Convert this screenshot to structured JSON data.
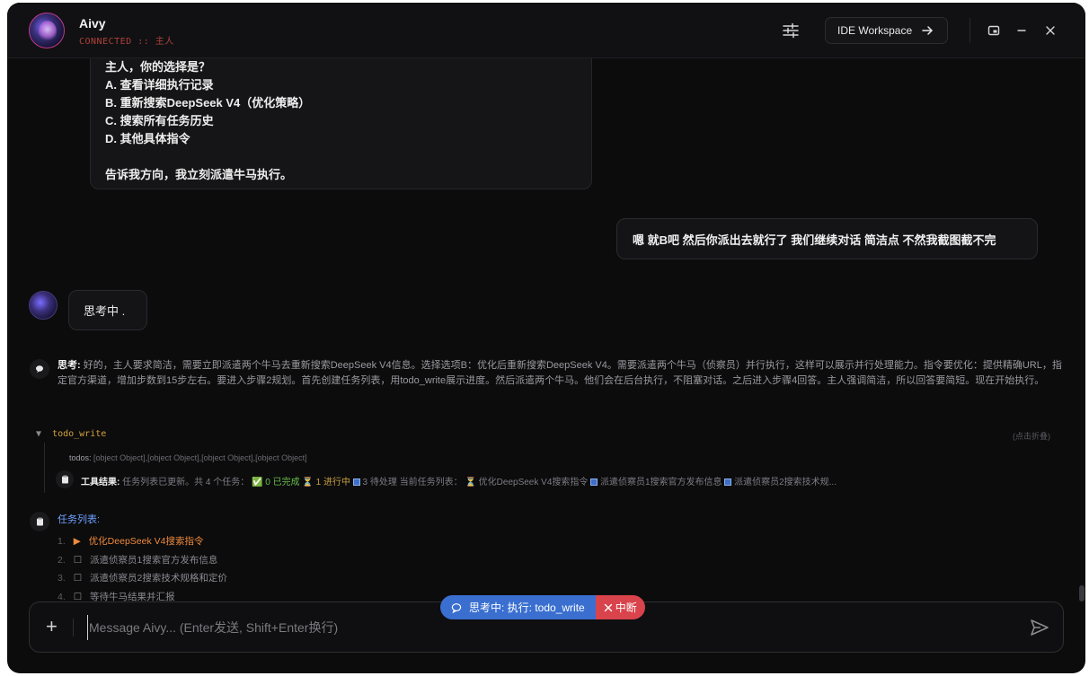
{
  "header": {
    "app_name": "Aivy",
    "connection_status": "CONNECTED :: 主人",
    "ide_button_label": "IDE Workspace",
    "icons": [
      "settings-sliders-icon",
      "arrow-right-icon",
      "picture-in-picture-icon",
      "minimize-icon",
      "close-icon"
    ]
  },
  "messages": {
    "ai_options": {
      "lines": [
        "主人，你的选择是？",
        "A. 查看详细执行记录",
        "B. 重新搜索DeepSeek V4（优化策略）",
        "C. 搜索所有任务历史",
        "D. 其他具体指令",
        "",
        "告诉我方向，我立刻派遣牛马执行。"
      ]
    },
    "user": {
      "text": "嗯 就B吧 然后你派出去就行了 我们继续对话 简洁点 不然我截图截不完"
    },
    "thinking_indicator": "思考中 .",
    "thinking": {
      "label": "思考:",
      "text": "好的，主人要求简洁，需要立即派遣两个牛马去重新搜索DeepSeek V4信息。选择选项B：优化后重新搜索DeepSeek V4。需要派遣两个牛马（侦察员）并行执行，这样可以展示并行处理能力。指令要优化：提供精确URL，指定官方渠道，增加步数到15步左右。要进入步骤2规划。首先创建任务列表，用todo_write展示进度。然后派遣两个牛马。他们会在后台执行，不阻塞对话。之后进入步骤4回答。主人强调简洁，所以回答要简短。现在开始执行。"
    },
    "tool": {
      "name": "todo_write",
      "collapse_hint": "(点击折叠)",
      "todos_label": "todos:",
      "todos_value": "[object Object],[object Object],[object Object],[object Object]",
      "result_label": "工具结果:",
      "result_text_1": "任务列表已更新。共 4 个任务：",
      "result_done": "✅ 0 已完成",
      "result_progress": "⏳ 1 进行中",
      "result_pending": "3 待处理",
      "result_text_2": "当前任务列表：",
      "result_item1": "⏳ 优化DeepSeek V4搜索指令",
      "result_item2": "派遣侦察员1搜索官方发布信息",
      "result_item3": "派遣侦察员2搜索技术规..."
    },
    "tasks": {
      "title": "任务列表:",
      "items": [
        {
          "num": "1.",
          "marker": "▶",
          "label": "优化DeepSeek V4搜索指令",
          "status": "in_progress"
        },
        {
          "num": "2.",
          "marker": "☐",
          "label": "派遣侦察员1搜索官方发布信息",
          "status": "pending"
        },
        {
          "num": "3.",
          "marker": "☐",
          "label": "派遣侦察员2搜索技术规格和定价",
          "status": "pending"
        },
        {
          "num": "4.",
          "marker": "☐",
          "label": "等待牛马结果并汇报",
          "status": "pending"
        }
      ]
    }
  },
  "status_pill": {
    "text": "思考中: 执行: todo_write",
    "stop_label": "中断"
  },
  "composer": {
    "placeholder": "Message Aivy... (Enter发送, Shift+Enter换行)",
    "value": ""
  },
  "colors": {
    "background": "#0c0c0d",
    "accent_blue": "#3a6fd0",
    "stop_red": "#d9434c",
    "tool_name_gold": "#d4a23a",
    "active_task_orange": "#f08a3c",
    "task_title_blue": "#6ea0ff",
    "status_red": "#b0413b"
  }
}
